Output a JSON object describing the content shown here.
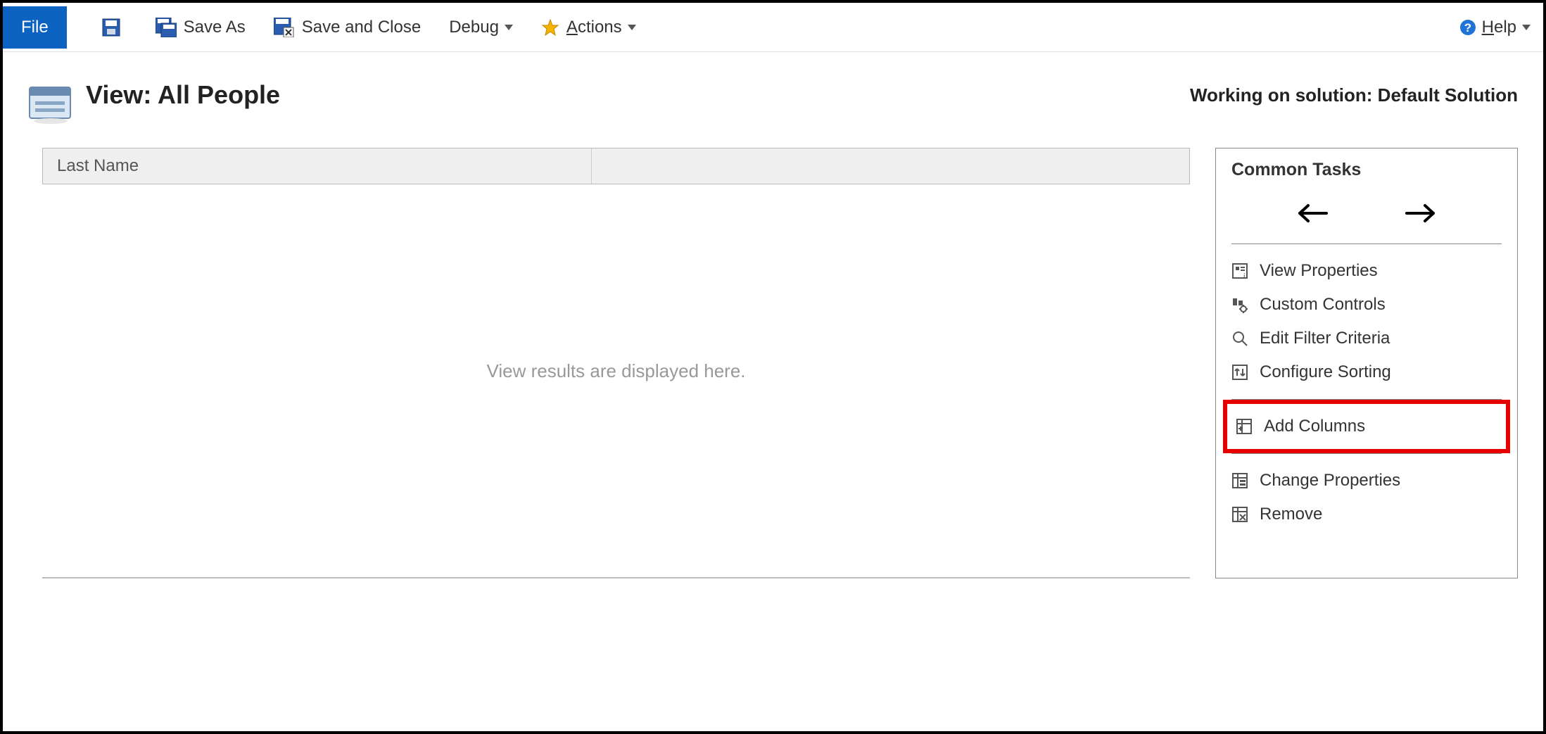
{
  "toolbar": {
    "file": "File",
    "save_as": "Save As",
    "save_and_close": "Save and Close",
    "debug": "Debug",
    "actions": "Actions",
    "help": "Help"
  },
  "header": {
    "title": "View: All People",
    "solution": "Working on solution: Default Solution"
  },
  "grid": {
    "columns": [
      "Last Name"
    ],
    "placeholder": "View results are displayed here."
  },
  "sidebar": {
    "title": "Common Tasks",
    "tasks_group1": [
      {
        "label": "View Properties"
      },
      {
        "label": "Custom Controls"
      },
      {
        "label": "Edit Filter Criteria"
      },
      {
        "label": "Configure Sorting"
      }
    ],
    "tasks_group2": [
      {
        "label": "Add Columns"
      }
    ],
    "tasks_group3": [
      {
        "label": "Change Properties"
      },
      {
        "label": "Remove"
      }
    ]
  }
}
